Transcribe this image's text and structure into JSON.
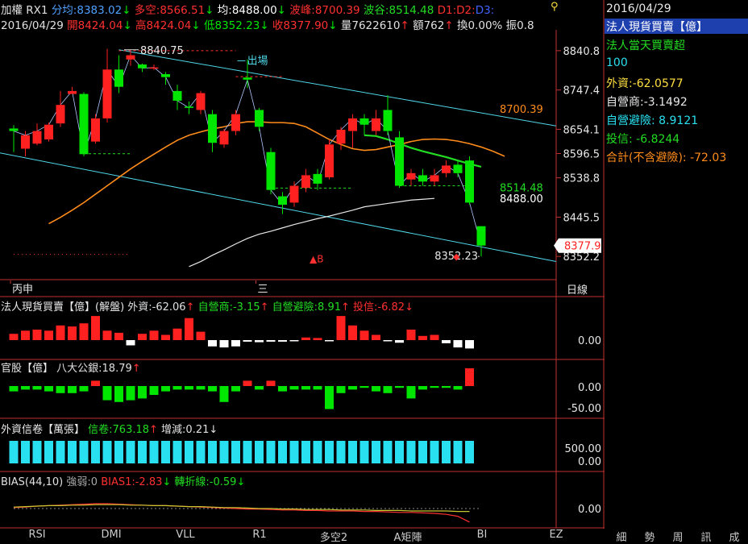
{
  "colors": {
    "up": "#ff2020",
    "down": "#00e600",
    "ma_fast": "#ff8c1a",
    "ma_mid": "#22dd22",
    "ma_slow": "#e8e8e8",
    "channel": "#4fd7e8",
    "bias_main": "#ff3030",
    "bias_line": "#c8c832",
    "inst": "#28e0f0"
  },
  "header": {
    "line1": [
      {
        "text": "加權 RX1 ",
        "color": "#e0e0e0"
      },
      {
        "text": "分均:8383.02",
        "color": "#4fa0ff"
      },
      {
        "text": "↓ ",
        "color": "#00e600"
      },
      {
        "text": "多空:8566.51",
        "color": "#ff3030"
      },
      {
        "text": "↓ ",
        "color": "#00e600"
      },
      {
        "text": "均:8488.00",
        "color": "#ffffff"
      },
      {
        "text": "↓ ",
        "color": "#00e600"
      },
      {
        "text": "波峰:8700.39",
        "color": "#ff3030"
      },
      {
        "text": " 波谷:8514.48",
        "color": "#22dd22"
      },
      {
        "text": " D1:",
        "color": "#ff3030"
      },
      {
        "text": "D2:",
        "color": "#ff3030"
      },
      {
        "text": "D3:",
        "color": "#4060ff"
      }
    ],
    "line2": [
      {
        "text": "2016/04/29 ",
        "color": "#e0e0e0"
      },
      {
        "text": "開8424.04",
        "color": "#ff3030"
      },
      {
        "text": "↓ ",
        "color": "#00e600"
      },
      {
        "text": "高8424.04",
        "color": "#ff3030"
      },
      {
        "text": "↓ ",
        "color": "#00e600"
      },
      {
        "text": "低8352.23",
        "color": "#00e600"
      },
      {
        "text": "↓ ",
        "color": "#00e600"
      },
      {
        "text": "收8377.90",
        "color": "#ff3030"
      },
      {
        "text": "↓ ",
        "color": "#00e600"
      },
      {
        "text": "量7622610",
        "color": "#e0e0e0"
      },
      {
        "text": "↑ ",
        "color": "#ff3030"
      },
      {
        "text": "額762",
        "color": "#e0e0e0"
      },
      {
        "text": "↑ ",
        "color": "#ff3030"
      },
      {
        "text": "換0.00%",
        "color": "#e0e0e0"
      },
      {
        "text": " 振0.8",
        "color": "#e0e0e0"
      }
    ],
    "pin_icon": "pin-icon"
  },
  "right_panel": {
    "date": "2016/04/29",
    "title": "法人現貨買賣【億】",
    "subtitle": "法人當天買賣超",
    "value100": "100",
    "foreign": "外資:-62.0577",
    "dealer": "自營商:-3.1492",
    "dealer_hedge": "自營避險: 8.9121",
    "trust": "投信: -6.8244",
    "total": "合計(不含避險): -72.03"
  },
  "chart_data": [
    {
      "type": "candlestick",
      "title": "",
      "x_labels": [
        {
          "index": 0,
          "label": "丙申"
        },
        {
          "index": 21,
          "label": "三"
        }
      ],
      "y_ticks": [
        8840.8,
        8747.4,
        8654.1,
        8596.5,
        8538.8,
        8445.5,
        8352.2
      ],
      "ylim": [
        8320,
        8875
      ],
      "candles": [
        {
          "o": 8656,
          "h": 8664,
          "l": 8600,
          "c": 8650
        },
        {
          "o": 8608,
          "h": 8650,
          "l": 8590,
          "c": 8640
        },
        {
          "o": 8620,
          "h": 8668,
          "l": 8616,
          "c": 8650
        },
        {
          "o": 8630,
          "h": 8670,
          "l": 8625,
          "c": 8665
        },
        {
          "o": 8668,
          "h": 8745,
          "l": 8660,
          "c": 8712
        },
        {
          "o": 8738,
          "h": 8755,
          "l": 8740,
          "c": 8745
        },
        {
          "o": 8738,
          "h": 8742,
          "l": 8590,
          "c": 8595
        },
        {
          "o": 8625,
          "h": 8690,
          "l": 8620,
          "c": 8680
        },
        {
          "o": 8680,
          "h": 8845,
          "l": 8670,
          "c": 8796
        },
        {
          "o": 8796,
          "h": 8830,
          "l": 8740,
          "c": 8755
        },
        {
          "o": 8820,
          "h": 8840,
          "l": 8805,
          "c": 8830
        },
        {
          "o": 8808,
          "h": 8810,
          "l": 8790,
          "c": 8799
        },
        {
          "o": 8799,
          "h": 8808,
          "l": 8795,
          "c": 8801
        },
        {
          "o": 8785,
          "h": 8790,
          "l": 8760,
          "c": 8778
        },
        {
          "o": 8745,
          "h": 8760,
          "l": 8700,
          "c": 8722
        },
        {
          "o": 8708,
          "h": 8720,
          "l": 8690,
          "c": 8705
        },
        {
          "o": 8700,
          "h": 8745,
          "l": 8690,
          "c": 8740
        },
        {
          "o": 8690,
          "h": 8700,
          "l": 8600,
          "c": 8622
        },
        {
          "o": 8618,
          "h": 8655,
          "l": 8610,
          "c": 8650
        },
        {
          "o": 8650,
          "h": 8700,
          "l": 8640,
          "c": 8690
        },
        {
          "o": 8777,
          "h": 8820,
          "l": 8752,
          "c": 8772
        },
        {
          "o": 8700,
          "h": 8705,
          "l": 8650,
          "c": 8660
        },
        {
          "o": 8600,
          "h": 8610,
          "l": 8500,
          "c": 8510
        },
        {
          "o": 8495,
          "h": 8505,
          "l": 8453,
          "c": 8475
        },
        {
          "o": 8480,
          "h": 8530,
          "l": 8470,
          "c": 8520
        },
        {
          "o": 8515,
          "h": 8560,
          "l": 8505,
          "c": 8545
        },
        {
          "o": 8548,
          "h": 8560,
          "l": 8510,
          "c": 8525
        },
        {
          "o": 8540,
          "h": 8630,
          "l": 8535,
          "c": 8618
        },
        {
          "o": 8620,
          "h": 8660,
          "l": 8605,
          "c": 8653
        },
        {
          "o": 8650,
          "h": 8690,
          "l": 8610,
          "c": 8680
        },
        {
          "o": 8680,
          "h": 8690,
          "l": 8640,
          "c": 8665
        },
        {
          "o": 8650,
          "h": 8700,
          "l": 8640,
          "c": 8680
        },
        {
          "o": 8700,
          "h": 8735,
          "l": 8640,
          "c": 8650
        },
        {
          "o": 8635,
          "h": 8650,
          "l": 8515,
          "c": 8520
        },
        {
          "o": 8535,
          "h": 8560,
          "l": 8520,
          "c": 8550
        },
        {
          "o": 8545,
          "h": 8560,
          "l": 8520,
          "c": 8530
        },
        {
          "o": 8530,
          "h": 8560,
          "l": 8520,
          "c": 8545
        },
        {
          "o": 8550,
          "h": 8580,
          "l": 8540,
          "c": 8568
        },
        {
          "o": 8570,
          "h": 8580,
          "l": 8540,
          "c": 8550
        },
        {
          "o": 8580,
          "h": 8590,
          "l": 8475,
          "c": 8480
        },
        {
          "o": 8424,
          "h": 8424,
          "l": 8352,
          "c": 8378
        }
      ],
      "ma_fast": [
        8430,
        8445,
        8462,
        8480,
        8500,
        8520,
        8540,
        8560,
        8578,
        8595,
        8612,
        8628,
        8640,
        8648,
        8655,
        8660,
        8668,
        8672,
        8672,
        8670,
        8670,
        8668,
        8660,
        8645,
        8630,
        8618,
        8608,
        8604,
        8606,
        8612,
        8618,
        8625,
        8630,
        8631,
        8630,
        8626,
        8620,
        8612,
        8602,
        8590
      ],
      "ma_fast_start": 3,
      "ma_mid": [
        8640,
        8638,
        8630,
        8620,
        8610,
        8602,
        8595,
        8588,
        8580,
        8572,
        8565
      ],
      "ma_mid_start": 30,
      "ma_slow": [
        8328,
        8340,
        8355,
        8368,
        8382,
        8395,
        8405,
        8412,
        8420,
        8428,
        8435,
        8442,
        8448,
        8455,
        8462,
        8470,
        8474,
        8478,
        8482,
        8486,
        8488,
        8490
      ],
      "ma_slow_start": 15,
      "annotations": [
        {
          "label": "8840.75",
          "index": 10,
          "value": 8840.75
        },
        {
          "label": "出場",
          "index": 19,
          "value": 8790
        },
        {
          "label": "8700.39",
          "value": 8700.39
        },
        {
          "label": "8514.48",
          "value": 8514.48
        },
        {
          "label": "8488.00",
          "value": 8488.0
        },
        {
          "label": "8352.23",
          "index": 40,
          "value": 8352.23
        },
        {
          "label": "▲B",
          "index": 24,
          "value": 8352
        },
        {
          "label": "8377.9",
          "value": 8377.9
        }
      ]
    },
    {
      "type": "bar",
      "title": "法人現貨買賣【億】(解盤)",
      "legend": [
        {
          "text": "外資:-62.06",
          "color": "#e0e0e0"
        },
        {
          "text": "↑ ",
          "color": "#ff3030"
        },
        {
          "text": "自營商:-3.15",
          "color": "#22dd22"
        },
        {
          "text": "↑ ",
          "color": "#ff3030"
        },
        {
          "text": "自營避險:8.91",
          "color": "#22dd22"
        },
        {
          "text": "↑ ",
          "color": "#ff3030"
        },
        {
          "text": "投信:-6.82",
          "color": "#ff3030"
        },
        {
          "text": "↓",
          "color": "#ff3030"
        }
      ],
      "y_tick": "0.00",
      "values": [
        12,
        18,
        20,
        18,
        28,
        26,
        32,
        46,
        18,
        14,
        -10,
        12,
        18,
        10,
        22,
        42,
        16,
        -12,
        -14,
        -12,
        -3,
        -4,
        -3,
        -3,
        -2,
        5,
        4,
        -2,
        46,
        28,
        18,
        10,
        -2,
        -5,
        20,
        8,
        10,
        -6,
        -14,
        -16
      ]
    },
    {
      "type": "bar",
      "title": "官股【億】",
      "legend": [
        {
          "text": "八大公銀:18.79",
          "color": "#e0e0e0"
        },
        {
          "text": "↑",
          "color": "#ff3030"
        }
      ],
      "y_ticks": [
        "0.00",
        "-50.00"
      ],
      "values": [
        -6,
        -4,
        -4,
        -6,
        -8,
        -8,
        -6,
        6,
        -16,
        -18,
        -16,
        -14,
        -10,
        -6,
        -4,
        -4,
        -4,
        -6,
        -18,
        -6,
        6,
        -4,
        6,
        -6,
        -4,
        -4,
        -4,
        -26,
        -8,
        -4,
        -2,
        -6,
        -8,
        -2,
        -14,
        -4,
        -2,
        -2,
        -4,
        20
      ]
    },
    {
      "type": "bar",
      "title": "外資信卷【萬張】",
      "legend": [
        {
          "text": "信卷:763.18",
          "color": "#22dd22"
        },
        {
          "text": "↑ ",
          "color": "#ff3030"
        },
        {
          "text": "增減:0.21",
          "color": "#e0e0e0"
        },
        {
          "text": "↓",
          "color": "#e0e0e0"
        }
      ],
      "y_ticks": [
        "500.00",
        "0.00"
      ],
      "values": [
        763,
        763,
        763,
        763,
        763,
        763,
        763,
        763,
        763,
        763,
        763,
        763,
        763,
        763,
        763,
        763,
        763,
        763,
        763,
        763,
        763,
        763,
        763,
        763,
        763,
        763,
        763,
        763,
        763,
        763,
        763,
        763,
        763,
        763,
        763,
        763,
        763,
        763,
        763,
        763
      ]
    },
    {
      "type": "line",
      "title": "",
      "legend": [
        {
          "text": "BIAS(44,10) ",
          "color": "#e0e0e0"
        },
        {
          "text": "強弱:0 ",
          "color": "#aaaaaa"
        },
        {
          "text": "BIAS1:-2.83",
          "color": "#ff3030"
        },
        {
          "text": "↓ ",
          "color": "#00e600"
        },
        {
          "text": "轉折線:-0.59",
          "color": "#22dd22"
        },
        {
          "text": "↓",
          "color": "#00e600"
        }
      ],
      "y_tick": "0.00",
      "series": [
        {
          "name": "BIAS1",
          "values": [
            0.2,
            0.3,
            0.5,
            0.6,
            0.7,
            0.8,
            0.9,
            1.0,
            1.0,
            0.9,
            0.8,
            0.7,
            0.6,
            0.6,
            0.5,
            0.4,
            0.3,
            0.2,
            0.1,
            0.0,
            -0.1,
            -0.1,
            -0.2,
            -0.3,
            -0.3,
            -0.4,
            -0.4,
            -0.5,
            -0.5,
            -0.5,
            -0.6,
            -0.6,
            -0.7,
            -0.8,
            -0.8,
            -0.9,
            -1.0,
            -1.2,
            -1.6,
            -2.8
          ]
        },
        {
          "name": "轉折線",
          "values": [
            0.3,
            0.4,
            0.5,
            0.6,
            0.6,
            0.7,
            0.7,
            0.8,
            0.8,
            0.8,
            0.7,
            0.7,
            0.6,
            0.6,
            0.5,
            0.4,
            0.4,
            0.3,
            0.2,
            0.2,
            0.1,
            0.0,
            0.0,
            -0.1,
            -0.1,
            -0.2,
            -0.2,
            -0.2,
            -0.3,
            -0.3,
            -0.3,
            -0.4,
            -0.4,
            -0.4,
            -0.5,
            -0.5,
            -0.5,
            -0.5,
            -0.6,
            -0.6
          ]
        }
      ]
    }
  ],
  "tabs": [
    "RSI",
    "DMI",
    "VLL",
    "R1",
    "多空2",
    "A矩陣",
    "BI",
    "EZ"
  ],
  "side_tabs": [
    "細",
    "勢",
    "周",
    "訊",
    "成"
  ],
  "axis_label": "日線"
}
